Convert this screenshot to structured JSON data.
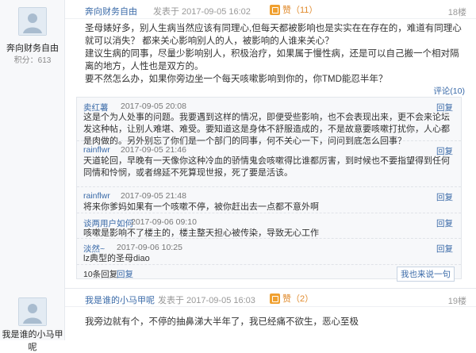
{
  "posts": [
    {
      "user": {
        "name": "奔向财务自由",
        "credits": "积分：613"
      },
      "author": "奔向财务自由",
      "date": "发表于 2017-09-05 16:02",
      "likes": "赞（11）",
      "floor": "18楼",
      "paragraphs": [
        "圣母婊好多，别人生病当然应该有同理心,但每天都被影响也是实实在在存在的，难道有同理心就可以消失？ 都来关心影响别人的人，被影响的人谁来关心？",
        "建议生病的同事，尽量少影响别人，积极治疗，如果属于慢性病，还是可以自己搬一个相对隔离的地方，人性也是双方的。",
        "要不然怎么办，如果你旁边坐一个每天咳嗽影响到你的，你TMD能忍半年？"
      ],
      "comment_link": "评论(10)",
      "comments": [
        {
          "name": "卖红薯",
          "time": "2017-09-05 20:08",
          "reply": "回复",
          "text": "这是个为人处事的问题。我要遇到这样的情况，即便受些影响，也不会表现出来，更不会来论坛发这种帖，让别人难堪、难受。要知道这是身体不舒服造成的，不是故意要咳嗽打扰你，人心都是肉做的。另外别忘了你们是一个部门的同事，何不关心一下，问问到底怎么回事？"
        },
        {
          "name": "rainflwr",
          "time": "2017-09-05 21:46",
          "reply": "回复",
          "text": "天道轮回，早晚有一天像你这种冷血的骄情鬼会咳嗽得比谁都厉害，到时候也不要指望得到任何同情和怜悯，或者绵延不死算现世报，死了要是活该。"
        },
        {
          "name": "rainflwr",
          "time": "2017-09-05 21:48",
          "reply": "回复",
          "text": "将来你爹妈如果有一个咳嗽不停，被你赶出去一点都不意外啊"
        },
        {
          "name": "谈两用户如何",
          "time": "2017-09-06 09:10",
          "reply": "回复",
          "text": "咳嗽是影响不了楼主的，楼主整天担心被传染，导致无心工作"
        },
        {
          "name": "淡然~",
          "time": "2017-09-06 10:25",
          "reply": "回复",
          "text": "lz典型的圣母diao"
        }
      ],
      "comment_footer": {
        "count": "10条回复",
        "expand": "回复",
        "me_too": "我也来说一句"
      }
    },
    {
      "user": {
        "name": "我是谁的小马甲呢"
      },
      "author": "我是谁的小马甲呢",
      "date": "发表于 2017-09-05 16:03",
      "likes": "赞（2）",
      "floor": "19楼",
      "paragraphs": [
        "我旁边就有个，不停的抽鼻涕大半年了，我已经痛不欲生，恶心至极"
      ]
    }
  ],
  "colors": {
    "link": "#3a6aa8",
    "like": "#e08a2c",
    "panel": "#f7f8fa"
  }
}
